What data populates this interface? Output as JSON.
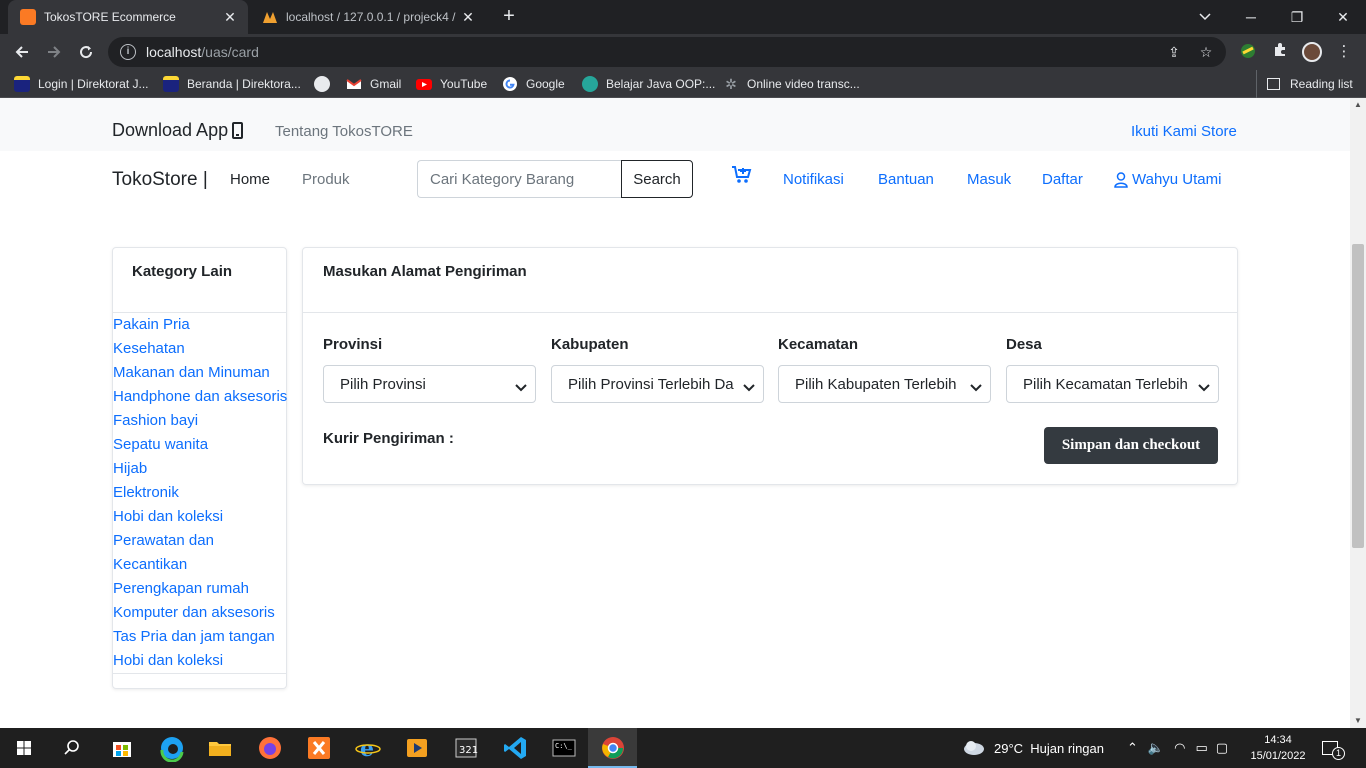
{
  "browser": {
    "tabs": [
      {
        "title": "TokosTORE Ecommerce",
        "active": true
      },
      {
        "title": "localhost / 127.0.0.1 / projeck4 /",
        "active": false
      }
    ],
    "url_host": "localhost",
    "url_path": "/uas/card",
    "bookmarks": [
      {
        "label": "Login | Direktorat J...",
        "icon": "bookmark-icon-yellow"
      },
      {
        "label": "Beranda | Direktora...",
        "icon": "bookmark-icon-yellow"
      },
      {
        "label": "",
        "icon": "globe-icon"
      },
      {
        "label": "Gmail",
        "icon": "gmail-icon"
      },
      {
        "label": "YouTube",
        "icon": "youtube-icon"
      },
      {
        "label": "Google",
        "icon": "google-icon"
      },
      {
        "label": "Belajar Java OOP:...",
        "icon": "java-icon"
      },
      {
        "label": "Online video transc...",
        "icon": "gear-icon"
      }
    ],
    "reading_list": "Reading list"
  },
  "topbar": {
    "download": "Download App",
    "tentang": "Tentang TokosTORE",
    "ikuti": "Ikuti Kami Store"
  },
  "navbar": {
    "brand": "TokoStore |",
    "home": "Home",
    "produk": "Produk",
    "search_placeholder": "Cari Kategory Barang",
    "search_button": "Search",
    "notifikasi": "Notifikasi",
    "bantuan": "Bantuan",
    "masuk": "Masuk",
    "daftar": "Daftar",
    "user": "Wahyu Utami"
  },
  "sidebar": {
    "title": "Kategory Lain",
    "items": [
      "Pakain Pria",
      "Kesehatan",
      "Makanan dan Minuman",
      "Handphone dan aksesoris",
      "Fashion bayi",
      "Sepatu wanita",
      "Hijab",
      "Elektronik",
      "Hobi dan koleksi",
      "Perawatan dan",
      "Kecantikan",
      "Perengkapan rumah",
      "Komputer dan aksesoris",
      "Tas Pria dan jam tangan",
      "Hobi dan koleksi"
    ]
  },
  "address": {
    "title": "Masukan Alamat Pengiriman",
    "fields": [
      {
        "label": "Provinsi",
        "value": "Pilih Provinsi"
      },
      {
        "label": "Kabupaten",
        "value": "Pilih Provinsi Terlebih Da"
      },
      {
        "label": "Kecamatan",
        "value": "Pilih Kabupaten Terlebih"
      },
      {
        "label": "Desa",
        "value": "Pilih Kecamatan Terlebih"
      }
    ],
    "kurir": "Kurir Pengiriman :",
    "checkout": "Simpan dan checkout"
  },
  "taskbar": {
    "weather": "29°C  Hujan ringan",
    "time": "14:34",
    "date": "15/01/2022",
    "notifications": "1"
  },
  "colors": {
    "link": "#0d6efd",
    "dark_button": "#343a40",
    "chrome_dark": "#202124",
    "chrome_mid": "#35363a"
  }
}
